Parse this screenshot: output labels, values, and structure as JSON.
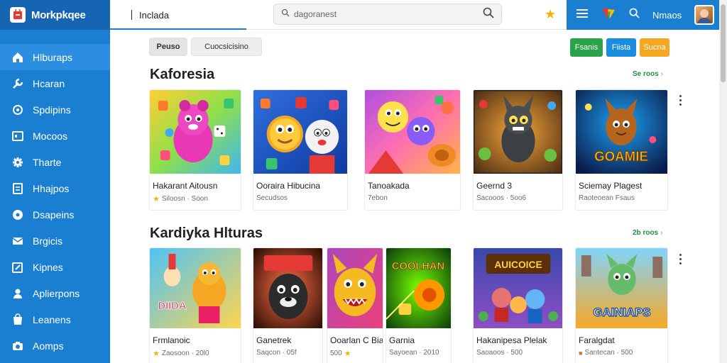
{
  "app": {
    "name": "Morkpkqee"
  },
  "sidebar": {
    "items": [
      {
        "label": "Hlburaps",
        "icon": "home-icon"
      },
      {
        "label": "Hcaran",
        "icon": "wrench-icon"
      },
      {
        "label": "Spdipins",
        "icon": "circle-icon"
      },
      {
        "label": "Mocoos",
        "icon": "card-icon"
      },
      {
        "label": "Tharte",
        "icon": "gear-icon"
      },
      {
        "label": "Hhajpos",
        "icon": "document-icon"
      },
      {
        "label": "Dsapeins",
        "icon": "disc-icon"
      },
      {
        "label": "Brgicis",
        "icon": "mail-icon"
      },
      {
        "label": "Kipnes",
        "icon": "edit-icon"
      },
      {
        "label": "Aplierpons",
        "icon": "users-icon"
      },
      {
        "label": "Leanens",
        "icon": "bag-icon"
      },
      {
        "label": "Aomps",
        "icon": "camera-icon"
      }
    ]
  },
  "topbar": {
    "tab_label": "Inclada",
    "search_placeholder": "dagoranest",
    "user_name": "Nmaos"
  },
  "filters": {
    "chip1": "Peuso",
    "chip2": "Cuocsicisino"
  },
  "pills": {
    "green": "Fsanis",
    "blue": "Fiista",
    "orange": "Sucna",
    "green_color": "#2aa34a",
    "blue_color": "#1c8ce0",
    "orange_color": "#f5a623"
  },
  "sections": [
    {
      "title": "Kaforesia",
      "see_all": "Se roos",
      "cards": [
        {
          "title": "Hakarant Aitousn",
          "meta": "Siloosn · Soon",
          "badge": "star"
        },
        {
          "title": "Ooraira Hibucina",
          "meta": "Secudsos",
          "badge": ""
        },
        {
          "title": "Tanoakada",
          "meta": "7ebon",
          "badge": ""
        },
        {
          "title": "Geernd 3",
          "meta": "Sacooos · 5oo6",
          "badge": ""
        },
        {
          "title": "Sciemay Plagest",
          "meta": "Raoteoean Fsaus",
          "badge": ""
        }
      ]
    },
    {
      "title": "Kardiyka Hlturas",
      "see_all": "2b roos",
      "cards": [
        {
          "title": "Frmlanoic",
          "meta": "Zaosoon · 20l0",
          "badge": "star"
        },
        {
          "title": "Ganetrek",
          "meta": "Saqcon · 05f",
          "badge": ""
        },
        {
          "title": "Ooarlan C Bial",
          "meta": "500",
          "badge": "star-right"
        },
        {
          "title": "Garnia",
          "meta": "Sayoean · 2010",
          "badge": ""
        },
        {
          "title": "Hakanipesa Plelak",
          "meta": "Saoaoos · 500",
          "badge": ""
        },
        {
          "title": "Faralgdat",
          "meta": "Santecan · 500",
          "badge": "flag"
        }
      ]
    }
  ],
  "thumb_text": {
    "r1c5": "GOAMIE",
    "r2c1": "DIIDA",
    "r2c4": "COOLHAN",
    "r2c5": "AUICOICE",
    "r2c6": "GAINIAPS"
  }
}
